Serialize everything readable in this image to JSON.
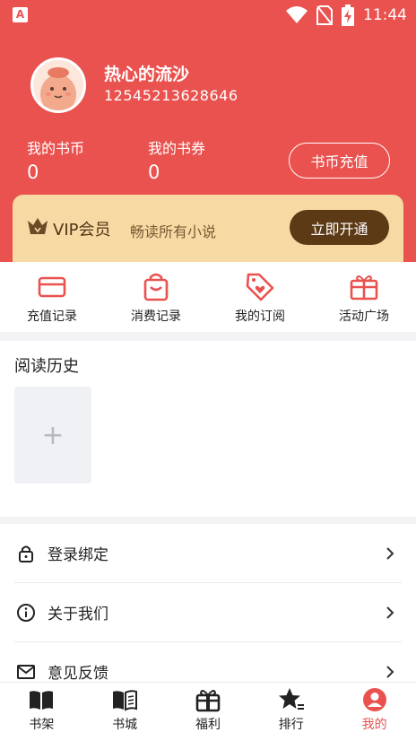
{
  "status_bar": {
    "app_icon_letter": "A",
    "time": "11:44"
  },
  "profile": {
    "name": "热心的流沙",
    "id": "12545213628646"
  },
  "wallet": {
    "coins_label": "我的书币",
    "coins_value": "0",
    "vouchers_label": "我的书券",
    "vouchers_value": "0",
    "recharge_label": "书币充值"
  },
  "vip": {
    "title": "VIP会员",
    "description": "畅读所有小说",
    "button_label": "立即开通"
  },
  "quick_menu": [
    {
      "label": "充值记录",
      "icon": "card-icon"
    },
    {
      "label": "消费记录",
      "icon": "shopping-bag-icon"
    },
    {
      "label": "我的订阅",
      "icon": "heart-tag-icon"
    },
    {
      "label": "活动广场",
      "icon": "gift-box-icon"
    }
  ],
  "history": {
    "title": "阅读历史",
    "add_symbol": "+"
  },
  "settings": [
    {
      "label": "登录绑定",
      "icon": "lock-icon"
    },
    {
      "label": "关于我们",
      "icon": "info-icon"
    },
    {
      "label": "意见反馈",
      "icon": "mail-icon"
    }
  ],
  "bottom_nav": [
    {
      "label": "书架",
      "icon": "open-book-icon",
      "active": false
    },
    {
      "label": "书城",
      "icon": "book-icon",
      "active": false
    },
    {
      "label": "福利",
      "icon": "gift-icon",
      "active": false
    },
    {
      "label": "排行",
      "icon": "star-icon",
      "active": false
    },
    {
      "label": "我的",
      "icon": "user-icon",
      "active": true
    }
  ],
  "colors": {
    "brand_red": "#e9524f",
    "vip_gold": "#f6d9a3",
    "vip_brown": "#5c3a16"
  }
}
